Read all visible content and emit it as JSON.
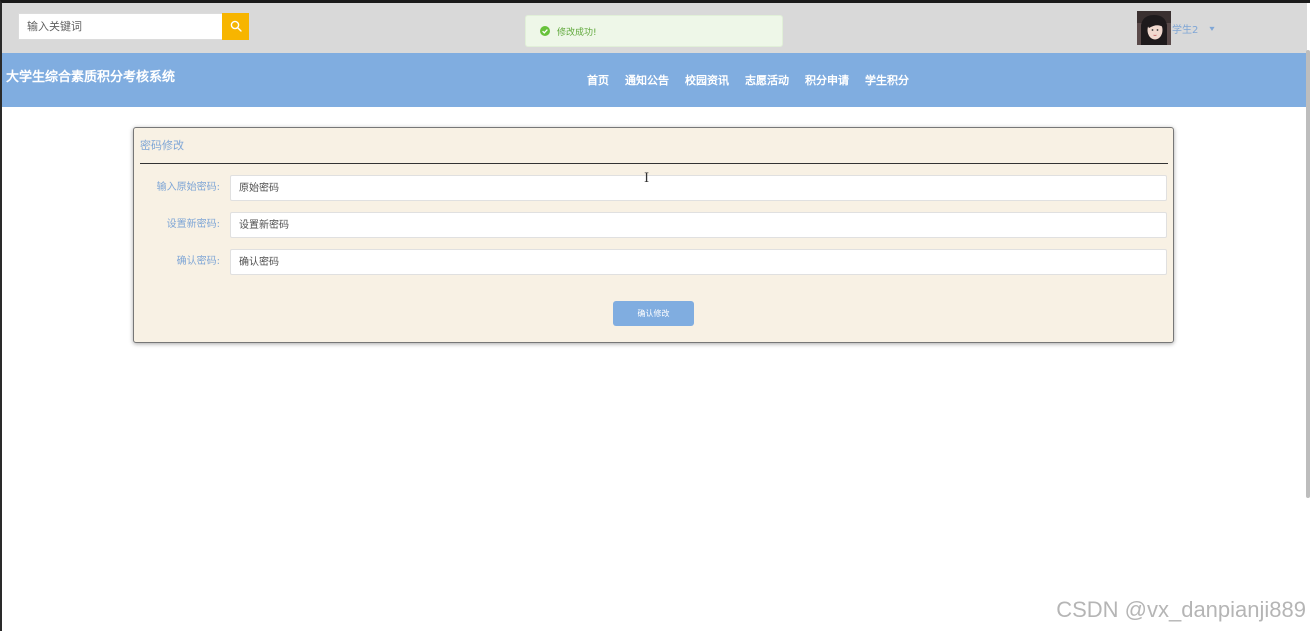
{
  "search": {
    "placeholder": "输入关键词",
    "icon": "search-icon"
  },
  "toast": {
    "message": "修改成功!",
    "icon": "check-circle-icon",
    "color": "#5fa83a"
  },
  "user": {
    "name": "学生2",
    "caret": "▾"
  },
  "brand": {
    "title": "大学生综合素质积分考核系统"
  },
  "nav": {
    "items": [
      "首页",
      "通知公告",
      "校园资讯",
      "志愿活动",
      "积分申请",
      "学生积分"
    ]
  },
  "panel": {
    "title": "密码修改",
    "fields": [
      {
        "label": "输入原始密码:",
        "placeholder": "原始密码"
      },
      {
        "label": "设置新密码:",
        "placeholder": "设置新密码"
      },
      {
        "label": "确认密码:",
        "placeholder": "确认密码"
      }
    ],
    "submit_label": "确认修改"
  },
  "colors": {
    "accent": "#80ade0",
    "search_button": "#f7b500",
    "panel_bg": "#f8f1e4",
    "topbar_bg": "#d9d9d9"
  },
  "watermark": "CSDN @vx_danpianji889"
}
